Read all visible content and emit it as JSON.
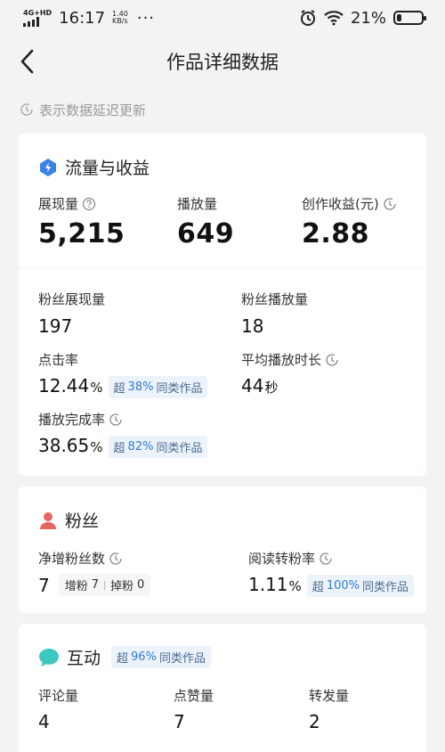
{
  "status_bar": {
    "network": "4G+HD",
    "time": "16:17",
    "speed_value": "1.40",
    "speed_unit": "KB/s",
    "more": "···",
    "battery_pct": "21%",
    "battery_level": 0.21
  },
  "header": {
    "title": "作品详细数据"
  },
  "notice": {
    "text": "表示数据延迟更新"
  },
  "traffic": {
    "title": "流量与收益",
    "impressions_label": "展现量",
    "impressions_value": "5,215",
    "plays_label": "播放量",
    "plays_value": "649",
    "earnings_label": "创作收益(元)",
    "earnings_value": "2.88",
    "fan_impressions_label": "粉丝展现量",
    "fan_impressions_value": "197",
    "fan_plays_label": "粉丝播放量",
    "fan_plays_value": "18",
    "ctr_label": "点击率",
    "ctr_value": "12.44",
    "ctr_unit": "%",
    "ctr_badge_prefix": "超",
    "ctr_badge_pct": "38%",
    "ctr_badge_suffix": "同类作品",
    "avg_duration_label": "平均播放时长",
    "avg_duration_value": "44",
    "avg_duration_unit": "秒",
    "completion_label": "播放完成率",
    "completion_value": "38.65",
    "completion_unit": "%",
    "completion_badge_prefix": "超",
    "completion_badge_pct": "82%",
    "completion_badge_suffix": "同类作品"
  },
  "fans": {
    "title": "粉丝",
    "net_growth_label": "净增粉丝数",
    "net_growth_value": "7",
    "gain_label": "增粉",
    "gain_value": "7",
    "loss_label": "掉粉",
    "loss_value": "0",
    "conversion_label": "阅读转粉率",
    "conversion_value": "1.11",
    "conversion_unit": "%",
    "conversion_badge_prefix": "超",
    "conversion_badge_pct": "100%",
    "conversion_badge_suffix": "同类作品"
  },
  "interaction": {
    "title": "互动",
    "badge_prefix": "超",
    "badge_pct": "96%",
    "badge_suffix": "同类作品",
    "comments_label": "评论量",
    "comments_value": "4",
    "likes_label": "点赞量",
    "likes_value": "7",
    "shares_label": "转发量",
    "shares_value": "2"
  },
  "colors": {
    "accent_blue": "#2f7ad6",
    "badge_bg": "#ecf3fb",
    "fans_icon": "#e5675f",
    "interaction_icon": "#3cc7c0",
    "traffic_icon": "#3b82e8"
  }
}
